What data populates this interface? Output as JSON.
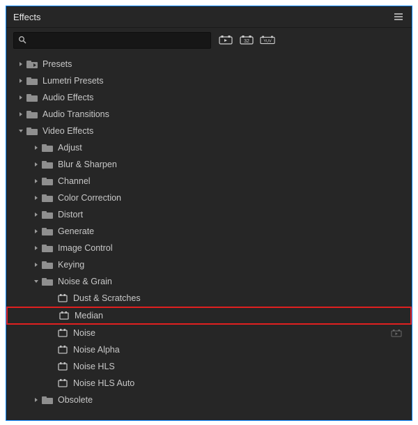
{
  "panel": {
    "title": "Effects"
  },
  "search": {
    "placeholder": ""
  },
  "filters": {
    "accelerated_label": "Accelerated Effects",
    "32bit_label": "32",
    "yuv_label": "YUV"
  },
  "tree": {
    "presets": "Presets",
    "lumetri_presets": "Lumetri Presets",
    "audio_effects": "Audio Effects",
    "audio_transitions": "Audio Transitions",
    "video_effects": "Video Effects",
    "ve": {
      "adjust": "Adjust",
      "blur_sharpen": "Blur & Sharpen",
      "channel": "Channel",
      "color_correction": "Color Correction",
      "distort": "Distort",
      "generate": "Generate",
      "image_control": "Image Control",
      "keying": "Keying",
      "noise_grain": "Noise & Grain",
      "obsolete": "Obsolete",
      "ng": {
        "dust_scratches": "Dust & Scratches",
        "median": "Median",
        "noise": "Noise",
        "noise_alpha": "Noise Alpha",
        "noise_hls": "Noise HLS",
        "noise_hls_auto": "Noise HLS Auto"
      }
    }
  }
}
